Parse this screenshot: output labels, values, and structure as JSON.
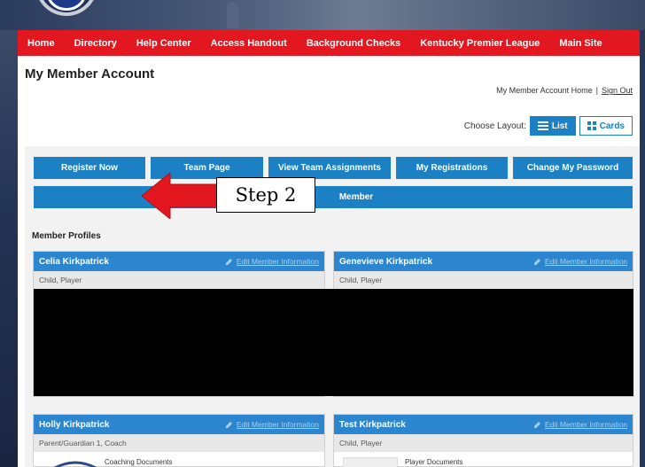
{
  "nav": {
    "items": [
      "Home",
      "Directory",
      "Help Center",
      "Access Handout",
      "Background Checks",
      "Kentucky Premier League",
      "Main Site"
    ]
  },
  "header": {
    "title": "My Member Account",
    "account_home": "My Member Account Home",
    "separator": "|",
    "sign_out": "Sign Out",
    "choose_layout": "Choose Layout:",
    "list_label": "List",
    "cards_label": "Cards"
  },
  "actions": {
    "register_now": "Register Now",
    "team_page": "Team Page",
    "view_team_assignments": "View Team Assignments",
    "my_registrations": "My Registrations",
    "change_password": "Change My Password",
    "add_member": "Member"
  },
  "callout": {
    "text": "Step 2",
    "color": "#e2171f"
  },
  "profiles": {
    "section_title": "Member Profiles",
    "edit_label": "Edit Member Information",
    "members": [
      {
        "name": "Celia Kirkpatrick",
        "roles": "Child, Player"
      },
      {
        "name": "Genevieve Kirkpatrick",
        "roles": "Child, Player"
      },
      {
        "name": "Holly Kirkpatrick",
        "roles": "Parent/Guardian 1, Coach",
        "doc": "Coaching Documents"
      },
      {
        "name": "Test Kirkpatrick",
        "roles": "Child, Player",
        "doc": "Player Documents"
      }
    ]
  },
  "colors": {
    "nav_red": "#e2171f",
    "button_blue": "#1b80c4",
    "card_head_blue": "#2c86cf"
  }
}
